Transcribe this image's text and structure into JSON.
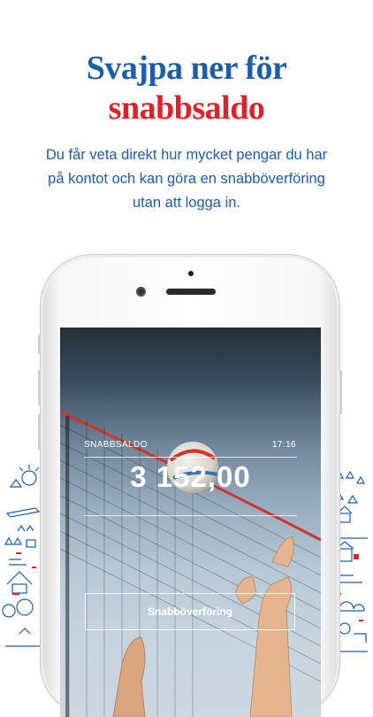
{
  "headline": {
    "line1": "Svajpa ner för",
    "line2": "snabbsaldo"
  },
  "subtitle": {
    "line1": "Du får veta direkt hur mycket pengar du har",
    "line2": "på kontot och kan göra en snabböverföring",
    "line3": "utan att logga in."
  },
  "screen": {
    "label": "SNABBSALDO",
    "time": "17:16",
    "balance": "3 152,00",
    "transfer_button": "Snabböverföring"
  },
  "colors": {
    "brand_blue": "#1d5ea8",
    "brand_red": "#e0202a"
  },
  "icons": [
    "camera-icon",
    "speaker-grille",
    "volleyball-image",
    "doodle-illustration"
  ]
}
